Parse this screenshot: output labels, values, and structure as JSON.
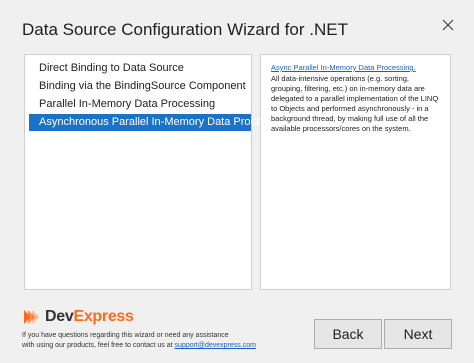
{
  "window": {
    "title": "Data Source Configuration Wizard for .NET"
  },
  "options": [
    {
      "label": "Direct Binding to Data Source",
      "selected": false
    },
    {
      "label": "Binding via the BindingSource Component",
      "selected": false
    },
    {
      "label": "Parallel In-Memory Data Processing",
      "selected": false
    },
    {
      "label": "Asynchronous Parallel In-Memory Data Processing",
      "selected": true
    }
  ],
  "description": {
    "link": "Async Parallel In-Memory Data Processing.",
    "text": "All data-intensive operations (e.g. sorting, grouping, filtering, etc.) on in-memory data are delegated to a parallel implementation of the LINQ to Objects and performed asynchronously - in a background thread, by making full use of all the available processors/cores on the system."
  },
  "footer": {
    "logo_dev": "Dev",
    "logo_express": "Express",
    "help_line1": "If you have questions regarding this wizard or need any assistance",
    "help_line2": "with using our products, feel free to contact us at ",
    "support_email": "support@devexpress.com",
    "back_label": "Back",
    "next_label": "Next"
  },
  "colors": {
    "selection": "#1a73c8",
    "logo_orange": "#ff6a1a",
    "link": "#1a5fc8"
  },
  "icons": [
    "close-icon",
    "devexpress-logo-icon"
  ]
}
